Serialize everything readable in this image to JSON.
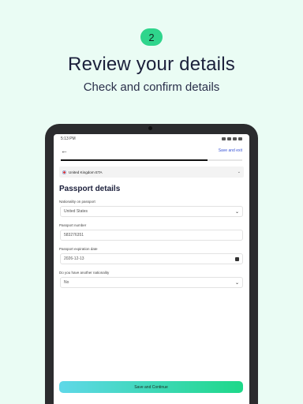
{
  "step": {
    "number": "2"
  },
  "header": {
    "title": "Review your details",
    "subtitle": "Check and confirm details"
  },
  "device": {
    "status_time": "5:13 PM"
  },
  "appbar": {
    "save_exit_label": "Save and exit",
    "progress_fraction": 0.81
  },
  "application": {
    "type_label": "United Kingdom ETA",
    "flag_icon": "uk-flag-icon"
  },
  "form": {
    "section_title": "Passport details",
    "nationality_label": "Nationality on passport",
    "nationality_value": "United States",
    "passport_number_label": "Passport number",
    "passport_number_value": "583276351",
    "expiration_label": "Passport expiration date",
    "expiration_value": "2026-12-13",
    "other_nationality_label": "Do you have another nationality",
    "other_nationality_value": "No"
  },
  "cta": {
    "label": "Save and Continue"
  },
  "colors": {
    "background": "#eafcf4",
    "accent_green": "#2fd58c",
    "link_blue": "#3a55d6",
    "cta_gradient_start": "#5fd8e8",
    "cta_gradient_end": "#1ed889"
  }
}
